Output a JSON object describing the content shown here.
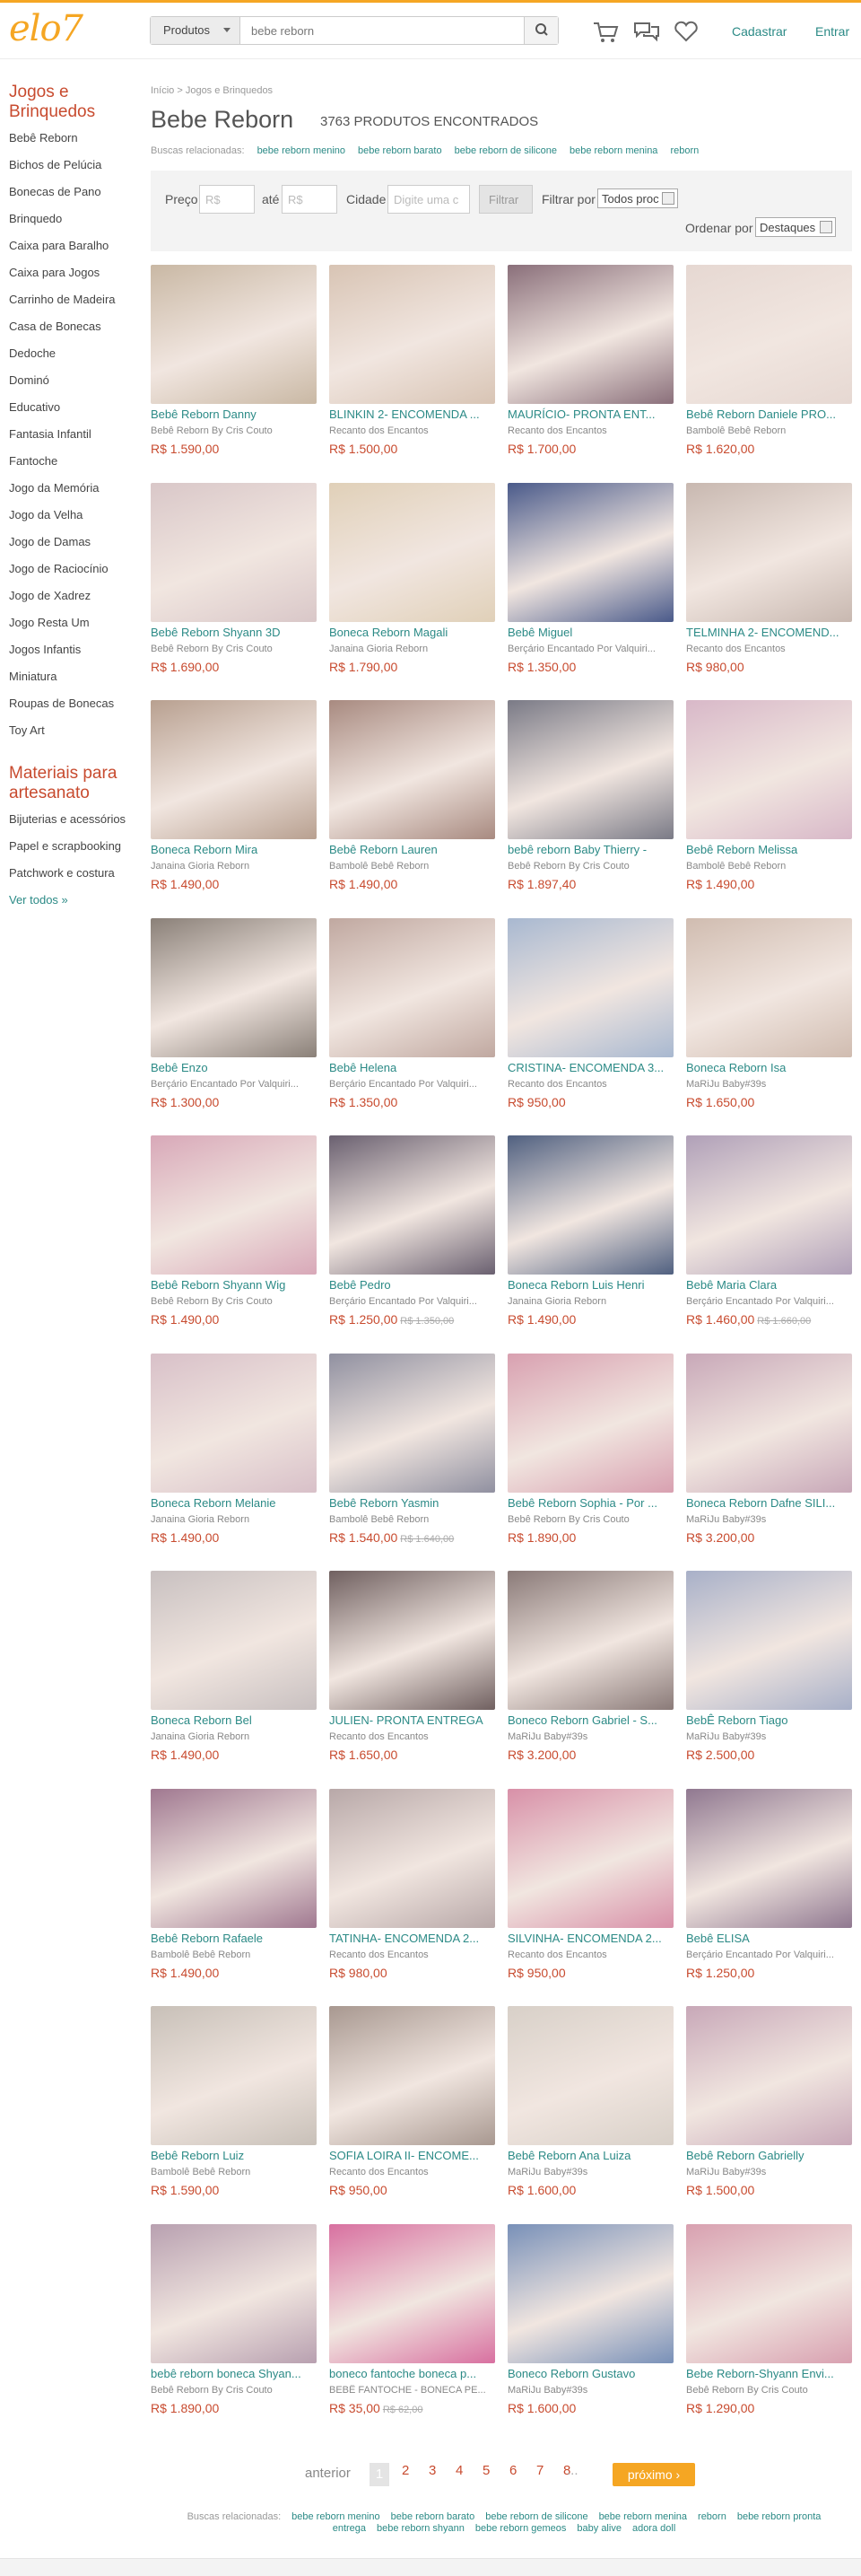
{
  "brand": {
    "logo": "elo7",
    "accent": "#f5a623",
    "link_color": "#2b8a86",
    "price_color": "#c84b2f"
  },
  "header": {
    "search_scope": "Produtos",
    "search_value": "bebe reborn",
    "cart_icon": "cart-icon",
    "messages_icon": "chat-icon",
    "favorites_icon": "heart-icon",
    "signup": "Cadastrar",
    "login": "Entrar"
  },
  "sidebar": {
    "title": "Jogos e Brinquedos",
    "items": [
      "Bebê Reborn",
      "Bichos de Pelúcia",
      "Bonecas de Pano",
      "Brinquedo",
      "Caixa para Baralho",
      "Caixa para Jogos",
      "Carrinho de Madeira",
      "Casa de Bonecas",
      "Dedoche",
      "Dominó",
      "Educativo",
      "Fantasia Infantil",
      "Fantoche",
      "Jogo da Memória",
      "Jogo da Velha",
      "Jogo de Damas",
      "Jogo de Raciocínio",
      "Jogo de Xadrez",
      "Jogo Resta Um",
      "Jogos Infantis",
      "Miniatura",
      "Roupas de Bonecas",
      "Toy Art"
    ],
    "materials_title": "Materiais para artesanato",
    "materials": [
      "Bijuterias e acessórios",
      "Papel e scrapbooking",
      "Patchwork e costura"
    ],
    "see_all": "Ver todos »"
  },
  "breadcrumb": "Início > Jogos e Brinquedos",
  "page_title": "Bebe Reborn",
  "result_count": "3763 PRODUTOS ENCONTRADOS",
  "related": {
    "label": "Buscas relacionadas:",
    "terms": [
      "bebe reborn menino",
      "bebe reborn barato",
      "bebe reborn de silicone",
      "bebe reborn menina",
      "reborn"
    ]
  },
  "filters": {
    "price_label": "Preço",
    "min_placeholder": "R$",
    "to_label": "até",
    "max_placeholder": "R$",
    "city_label": "Cidade",
    "city_placeholder": "Digite uma c",
    "filter_button": "Filtrar",
    "filter_by_label": "Filtrar por",
    "filter_by_value": "Todos proc",
    "sort_label": "Ordenar por",
    "sort_value": "Destaques"
  },
  "products": [
    {
      "name": "Bebê Reborn Danny",
      "shop": "Bebê Reborn By Cris Couto",
      "price": "R$ 1.590,00",
      "old": "",
      "color": "#c9b8a4"
    },
    {
      "name": "BLINKIN 2- ENCOMENDA ...",
      "shop": "Recanto dos Encantos",
      "price": "R$ 1.500,00",
      "old": "",
      "color": "#d8c4b4"
    },
    {
      "name": "MAURÍCIO- PRONTA ENT...",
      "shop": "Recanto dos Encantos",
      "price": "R$ 1.700,00",
      "old": "",
      "color": "#8a6f7a"
    },
    {
      "name": "Bebê Reborn Daniele PRO...",
      "shop": "Bambolê Bebê Reborn",
      "price": "R$ 1.620,00",
      "old": "",
      "color": "#e6d8d2"
    },
    {
      "name": "Bebê Reborn Shyann 3D",
      "shop": "Bebê Reborn By Cris Couto",
      "price": "R$ 1.690,00",
      "old": "",
      "color": "#d9c7c8"
    },
    {
      "name": "Boneca Reborn Magali",
      "shop": "Janaina Gioria Reborn",
      "price": "R$ 1.790,00",
      "old": "",
      "color": "#e0d0b8"
    },
    {
      "name": "Bebê Miguel",
      "shop": "Berçário Encantado Por Valquiri...",
      "price": "R$ 1.350,00",
      "old": "",
      "color": "#4a5a8a"
    },
    {
      "name": "TELMINHA 2- ENCOMEND...",
      "shop": "Recanto dos Encantos",
      "price": "R$ 980,00",
      "old": "",
      "color": "#c8b8b0"
    },
    {
      "name": "Boneca Reborn Mira",
      "shop": "Janaina Gioria Reborn",
      "price": "R$ 1.490,00",
      "old": "",
      "color": "#b8a090"
    },
    {
      "name": "Bebê Reborn Lauren",
      "shop": "Bambolê Bebê Reborn",
      "price": "R$ 1.490,00",
      "old": "",
      "color": "#a88a80"
    },
    {
      "name": "bebê reborn Baby Thierry -",
      "shop": "Bebê Reborn By Cris Couto",
      "price": "R$ 1.897,40",
      "old": "",
      "color": "#7a7a86"
    },
    {
      "name": "Bebê Reborn Melissa",
      "shop": "Bambolê Bebê Reborn",
      "price": "R$ 1.490,00",
      "old": "",
      "color": "#d8b8c8"
    },
    {
      "name": "Bebê Enzo",
      "shop": "Berçário Encantado Por Valquiri...",
      "price": "R$ 1.300,00",
      "old": "",
      "color": "#8a8078"
    },
    {
      "name": "Bebê Helena",
      "shop": "Berçário Encantado Por Valquiri...",
      "price": "R$ 1.350,00",
      "old": "",
      "color": "#c0a8a0"
    },
    {
      "name": "CRISTINA- ENCOMENDA 3...",
      "shop": "Recanto dos Encantos",
      "price": "R$ 950,00",
      "old": "",
      "color": "#a8b8d0"
    },
    {
      "name": "Boneca Reborn Isa",
      "shop": "MaRiJu Baby#39s",
      "price": "R$ 1.650,00",
      "old": "",
      "color": "#d0bcb0"
    },
    {
      "name": "Bebê Reborn Shyann Wig",
      "shop": "Bebê Reborn By Cris Couto",
      "price": "R$ 1.490,00",
      "old": "",
      "color": "#d8a8b8"
    },
    {
      "name": "Bebê Pedro",
      "shop": "Berçário Encantado Por Valquiri...",
      "price": "R$ 1.250,00",
      "old": "R$ 1.350,00",
      "color": "#6a6070"
    },
    {
      "name": "Boneca Reborn Luis Henri",
      "shop": "Janaina Gioria Reborn",
      "price": "R$ 1.490,00",
      "old": "",
      "color": "#506080"
    },
    {
      "name": "Bebê Maria Clara",
      "shop": "Berçário Encantado Por Valquiri...",
      "price": "R$ 1.460,00",
      "old": "R$ 1.660,00",
      "color": "#b0a0b8"
    },
    {
      "name": "Boneca Reborn Melanie",
      "shop": "Janaina Gioria Reborn",
      "price": "R$ 1.490,00",
      "old": "",
      "color": "#d8c0c8"
    },
    {
      "name": "Bebê Reborn Yasmin",
      "shop": "Bambolê Bebê Reborn",
      "price": "R$ 1.540,00",
      "old": "R$ 1.640,00",
      "color": "#9090a0"
    },
    {
      "name": "Bebê Reborn Sophia - Por ...",
      "shop": "Bebê Reborn By Cris Couto",
      "price": "R$ 1.890,00",
      "old": "",
      "color": "#d8a0b0"
    },
    {
      "name": "Boneca Reborn Dafne SILI...",
      "shop": "MaRiJu Baby#39s",
      "price": "R$ 3.200,00",
      "old": "",
      "color": "#c8a8b8"
    },
    {
      "name": "Boneca Reborn Bel",
      "shop": "Janaina Gioria Reborn",
      "price": "R$ 1.490,00",
      "old": "",
      "color": "#c8c0c0"
    },
    {
      "name": "JULIEN- PRONTA ENTREGA",
      "shop": "Recanto dos Encantos",
      "price": "R$ 1.650,00",
      "old": "",
      "color": "#706060"
    },
    {
      "name": "Boneco Reborn Gabriel - S...",
      "shop": "MaRiJu Baby#39s",
      "price": "R$ 3.200,00",
      "old": "",
      "color": "#8a7a78"
    },
    {
      "name": "BebÊ Reborn Tiago",
      "shop": "MaRiJu Baby#39s",
      "price": "R$ 2.500,00",
      "old": "",
      "color": "#a8b0c8"
    },
    {
      "name": "Bebê Reborn Rafaele",
      "shop": "Bambolê Bebê Reborn",
      "price": "R$ 1.490,00",
      "old": "",
      "color": "#a07890"
    },
    {
      "name": "TATINHA- ENCOMENDA 2...",
      "shop": "Recanto dos Encantos",
      "price": "R$ 980,00",
      "old": "",
      "color": "#b8a8a8"
    },
    {
      "name": "SILVINHA- ENCOMENDA 2...",
      "shop": "Recanto dos Encantos",
      "price": "R$ 950,00",
      "old": "",
      "color": "#d890a8"
    },
    {
      "name": "Bebê ELISA",
      "shop": "Berçário Encantado Por Valquiri...",
      "price": "R$ 1.250,00",
      "old": "",
      "color": "#907890"
    },
    {
      "name": "Bebê Reborn Luiz",
      "shop": "Bambolê Bebê Reborn",
      "price": "R$ 1.590,00",
      "old": "",
      "color": "#c8c0b8"
    },
    {
      "name": "SOFIA LOIRA II- ENCOME...",
      "shop": "Recanto dos Encantos",
      "price": "R$ 950,00",
      "old": "",
      "color": "#a89890"
    },
    {
      "name": "Bebê Reborn Ana Luiza",
      "shop": "MaRiJu Baby#39s",
      "price": "R$ 1.600,00",
      "old": "",
      "color": "#d8d0c8"
    },
    {
      "name": "Bebê Reborn Gabrielly",
      "shop": "MaRiJu Baby#39s",
      "price": "R$ 1.500,00",
      "old": "",
      "color": "#c8a8b8"
    },
    {
      "name": "bebê reborn boneca Shyan...",
      "shop": "Bebê Reborn By Cris Couto",
      "price": "R$ 1.890,00",
      "old": "",
      "color": "#b8a0b0"
    },
    {
      "name": "boneco fantoche boneca p...",
      "shop": "BEBÊ FANTOCHE - BONECA PE...",
      "price": "R$ 35,00",
      "old": "R$ 62,00",
      "color": "#d870a0"
    },
    {
      "name": "Boneco Reborn Gustavo",
      "shop": "MaRiJu Baby#39s",
      "price": "R$ 1.600,00",
      "old": "",
      "color": "#7890b8"
    },
    {
      "name": "Bebe Reborn-Shyann Envi...",
      "shop": "Bebê Reborn By Cris Couto",
      "price": "R$ 1.290,00",
      "old": "",
      "color": "#d8a0b0"
    }
  ],
  "pager": {
    "prev": "anterior",
    "current": "1",
    "pages": [
      "2",
      "3",
      "4",
      "5",
      "6",
      "7",
      "8"
    ],
    "ellipsis": "...",
    "next": "próximo ›"
  },
  "footer_related": {
    "label": "Buscas relacionadas:",
    "terms": [
      "bebe reborn menino",
      "bebe reborn barato",
      "bebe reborn de silicone",
      "bebe reborn menina",
      "reborn",
      "bebe reborn pronta entrega",
      "bebe reborn shyann",
      "bebe reborn gemeos",
      "baby alive",
      "adora doll"
    ]
  }
}
